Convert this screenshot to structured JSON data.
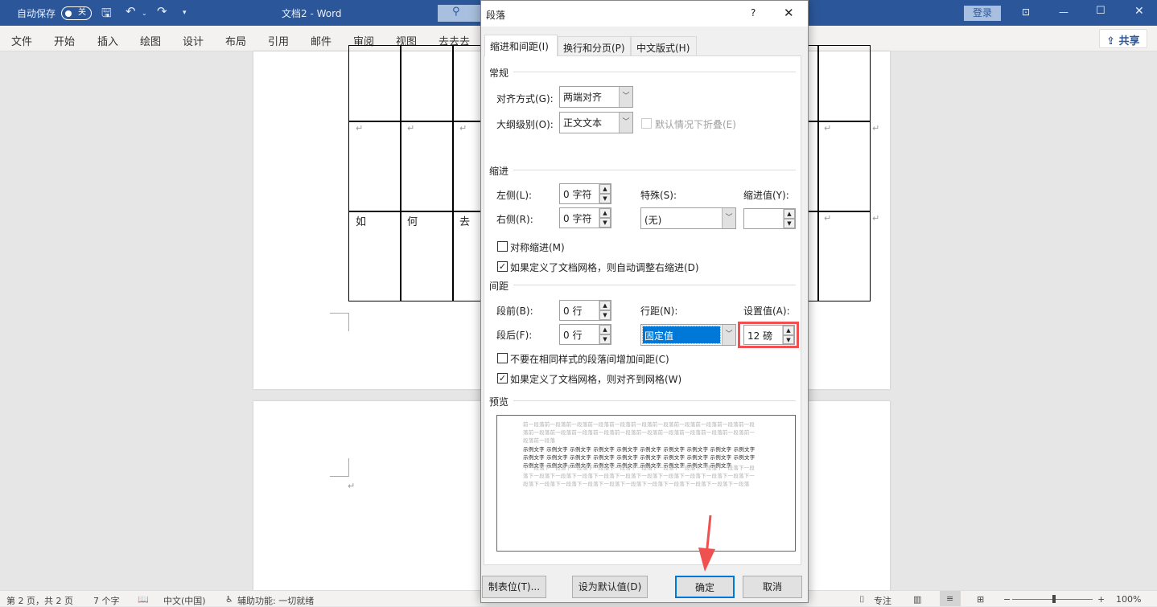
{
  "titlebar": {
    "autosave_label": "自动保存",
    "autosave_state": "关",
    "title": "文档2  -  Word",
    "login": "登录"
  },
  "menu": [
    "文件",
    "开始",
    "插入",
    "绘图",
    "设计",
    "布局",
    "引用",
    "邮件",
    "审阅",
    "视图",
    "去去去"
  ],
  "share": "共享",
  "document": {
    "row3_cells": [
      "如",
      "何",
      "去"
    ],
    "pilcrow": "↵"
  },
  "dialog": {
    "title": "段落",
    "help": "?",
    "tabs": [
      "缩进和间距(I)",
      "换行和分页(P)",
      "中文版式(H)"
    ],
    "general": {
      "heading": "常规",
      "align_label": "对齐方式(G):",
      "align_value": "两端对齐",
      "outline_label": "大纲级别(O):",
      "outline_value": "正文文本",
      "collapse_label": "默认情况下折叠(E)"
    },
    "indent": {
      "heading": "缩进",
      "left_label": "左侧(L):",
      "left_value": "0 字符",
      "right_label": "右侧(R):",
      "right_value": "0 字符",
      "special_label": "特殊(S):",
      "special_value": "(无)",
      "by_label": "缩进值(Y):",
      "by_value": "",
      "mirror_label": "对称缩进(M)",
      "mirror_checked": false,
      "auto_adjust_label": "如果定义了文档网格，则自动调整右缩进(D)",
      "auto_adjust_checked": true
    },
    "spacing": {
      "heading": "间距",
      "before_label": "段前(B):",
      "before_value": "0 行",
      "after_label": "段后(F):",
      "after_value": "0 行",
      "line_label": "行距(N):",
      "line_value": "固定值",
      "at_label": "设置值(A):",
      "at_value": "12 磅",
      "no_space_label": "不要在相同样式的段落间增加间距(C)",
      "no_space_checked": false,
      "snap_label": "如果定义了文档网格，则对齐到网格(W)",
      "snap_checked": true
    },
    "preview": {
      "heading": "预览",
      "before_text": "前一段落前一段落前一段落前一段落前一段落前一段落前一段落前一段落前一段落前一段落前一段落前一段落前一段落前一段落前一段落前一段落前一段落前一段落前一段落前一段落前一段落前一段落前一段落",
      "sample_text": "示例文字 示例文字 示例文字 示例文字 示例文字 示例文字 示例文字 示例文字 示例文字 示例文字 示例文字 示例文字 示例文字 示例文字 示例文字 示例文字 示例文字 示例文字 示例文字 示例文字 示例文字 示例文字 示例文字 示例文字 示例文字 示例文字 示例文字 示例文字 示例文字",
      "after_text": "下一段落下一段落下一段落下一段落下一段落下一段落下一段落下一段落下一段落下一段落下一段落下一段落下一段落下一段落下一段落下一段落下一段落下一段落下一段落下一段落下一段落下一段落下一段落下一段落下一段落下一段落下一段落下一段落下一段落下一段落下一段落下一段落"
    },
    "buttons": {
      "tabs": "制表位(T)...",
      "default": "设为默认值(D)",
      "ok": "确定",
      "cancel": "取消"
    }
  },
  "status": {
    "page": "第 2 页，共 2 页",
    "words": "7 个字",
    "language": "中文(中国)",
    "accessibility": "辅助功能: 一切就绪",
    "focus": "专注",
    "zoom": "100%",
    "zoom_percent": 100
  },
  "colors": {
    "titlebar": "#2b579a",
    "highlight_box": "#f05050",
    "selection": "#0078d7"
  }
}
